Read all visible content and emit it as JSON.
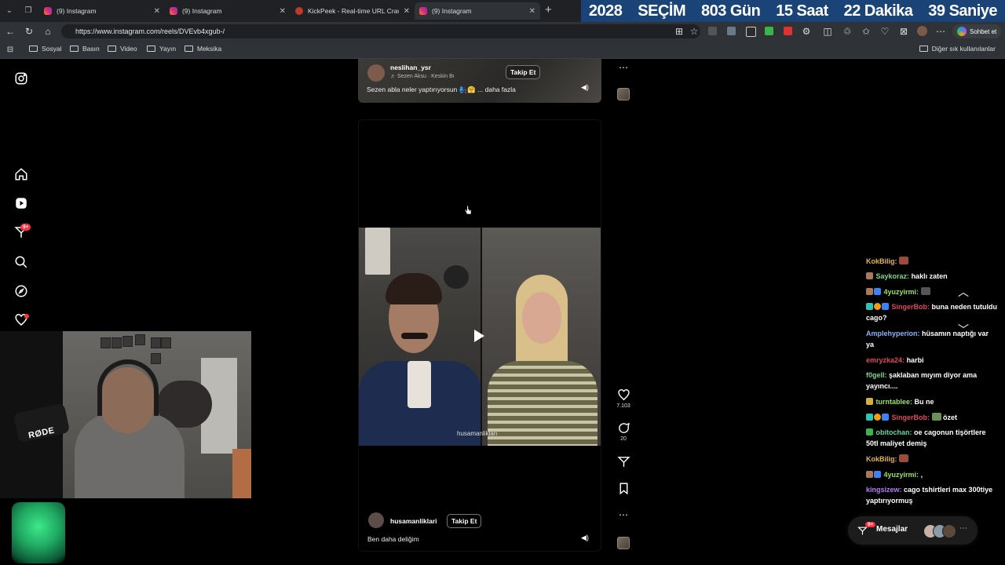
{
  "browser": {
    "tabs": [
      {
        "title": "(9) Instagram",
        "favicon": "instagram-icon"
      },
      {
        "title": "(9) Instagram",
        "favicon": "instagram-icon"
      },
      {
        "title": "KickPeek - Real-time URL Crawler",
        "favicon": "kickpeek-icon"
      },
      {
        "title": "(9) Instagram",
        "favicon": "instagram-icon"
      }
    ],
    "url": "https://www.instagram.com/reels/DVEvb4xgub-/",
    "copilot_label": "Sohbet et",
    "bookmarks": [
      "Sosyal",
      "Basın",
      "Video",
      "Yayın",
      "Meksika"
    ],
    "other_bookmarks": "Diğer sık kullanılanlar"
  },
  "countdown": {
    "year": "2028",
    "label": "SEÇİM",
    "days": "803 Gün",
    "hours": "15 Saat",
    "minutes": "22 Dakika",
    "seconds": "39 Saniye",
    "bg_color": "#1a4478"
  },
  "sidebar": {
    "notification_badge": "9+"
  },
  "reel_top": {
    "username": "neslihan_ysr",
    "music": "Sezen Aksu · Keskin Bı",
    "follow_label": "Takip Et",
    "caption": "Sezen abla neler yaptırıyorsun 🧞‍♀️🤗 ... daha fazla"
  },
  "reel_main": {
    "watermark": "husamanliklari",
    "username": "husamanliklari",
    "follow_label": "Takip Et",
    "caption": "Ben daha deliğim",
    "likes": "7.103",
    "comments": "20"
  },
  "webcam": {
    "mic_brand": "RØDE"
  },
  "chat": [
    {
      "user": "KokBilig:",
      "text": "",
      "color": "#e6b450"
    },
    {
      "user": "Saykoraz:",
      "text": "haklı zaten",
      "color": "#7bd88f"
    },
    {
      "user": "4yuzyirmi:",
      "text": "",
      "color": "#9be15d"
    },
    {
      "user": "SingerBob:",
      "text": "buna neden tutuldu cago?",
      "color": "#e0475b"
    },
    {
      "user": "Amplehyperion:",
      "text": "hüsamın naptığı var ya",
      "color": "#8ab4f8"
    },
    {
      "user": "emryzka24:",
      "text": "harbi",
      "color": "#e0475b"
    },
    {
      "user": "f0gell:",
      "text": "şaklaban mıyım diyor ama yayıncı....",
      "color": "#7bd88f"
    },
    {
      "user": "turntablee:",
      "text": "Bu ne",
      "color": "#9be15d"
    },
    {
      "user": "SingerBob:",
      "text": "özet",
      "color": "#e0475b"
    },
    {
      "user": "obitochan:",
      "text": "oe cagonun tişörtlere 50tl maliyet demiş",
      "color": "#5fd4a0"
    },
    {
      "user": "KokBilig:",
      "text": "",
      "color": "#e6b450"
    },
    {
      "user": "4yuzyirmi:",
      "text": ",",
      "color": "#9be15d"
    },
    {
      "user": "kingsizew:",
      "text": "cago tshirtleri max 300tiye yaptırıyormuş",
      "color": "#b57cff"
    }
  ],
  "messages": {
    "label": "Mesajlar",
    "badge": "9+"
  }
}
